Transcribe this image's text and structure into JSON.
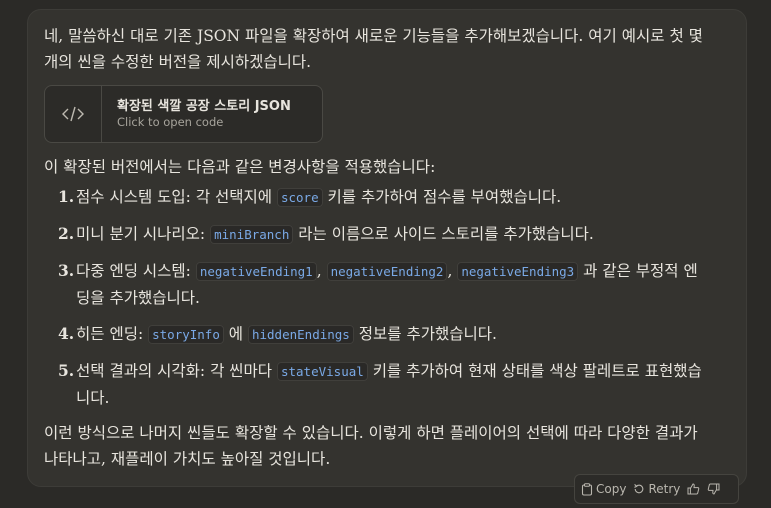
{
  "message": {
    "intro": "네, 말씀하신 대로 기존 JSON 파일을 확장하여 새로운 기능들을 추가해보겠습니다. 여기 예시로 첫 몇 개의 씬을 수정한 버전을 제시하겠습니다.",
    "artifact": {
      "title": "확장된 색깔 공장 스토리 JSON",
      "subtitle": "Click to open code",
      "icon": "code-icon"
    },
    "lead": "이 확장된 버전에서는 다음과 같은 변경사항을 적용했습니다:",
    "items": [
      {
        "num": "1.",
        "pre": "점수 시스템 도입: 각 선택지에 ",
        "codes": [
          "score"
        ],
        "post": " 키를 추가하여 점수를 부여했습니다."
      },
      {
        "num": "2.",
        "pre": "미니 분기 시나리오: ",
        "codes": [
          "miniBranch"
        ],
        "post": " 라는 이름으로 사이드 스토리를 추가했습니다."
      },
      {
        "num": "3.",
        "pre": "다중 엔딩 시스템: ",
        "codes": [
          "negativeEnding1",
          "negativeEnding2",
          "negativeEnding3"
        ],
        "post": " 과 같은 부정적 엔딩을 추가했습니다."
      },
      {
        "num": "4.",
        "pre": "히든 엔딩: ",
        "codes": [
          "storyInfo",
          "hiddenEndings"
        ],
        "mid": " 에 ",
        "post": " 정보를 추가했습니다."
      },
      {
        "num": "5.",
        "pre": "선택 결과의 시각화: 각 씬마다 ",
        "codes": [
          "stateVisual"
        ],
        "post": " 키를 추가하여 현재 상태를 색상 팔레트로 표현했습니다."
      }
    ],
    "outro": "이런 방식으로 나머지 씬들도 확장할 수 있습니다. 이렇게 하면 플레이어의 선택에 따라 다양한 결과가 나타나고, 재플레이 가치도 높아질 것입니다."
  },
  "actions": {
    "copy": "Copy",
    "retry": "Retry",
    "icons": [
      "clipboard-icon",
      "retry-icon",
      "thumbs-up-icon",
      "thumbs-down-icon"
    ]
  }
}
